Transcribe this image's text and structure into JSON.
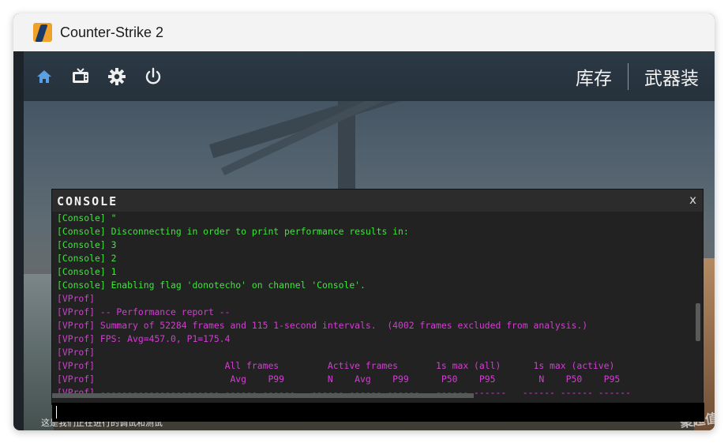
{
  "window": {
    "title": "Counter-Strike 2"
  },
  "nav": {
    "icons": [
      "home-icon",
      "tv-icon",
      "gear-icon",
      "power-icon"
    ],
    "items": [
      {
        "label": "库存"
      },
      {
        "label": "武器装"
      }
    ]
  },
  "console": {
    "title": "CONSOLE",
    "close_label": "x",
    "lines": [
      {
        "text": "[Console] \"",
        "color": "green"
      },
      {
        "text": "[Console] Disconnecting in order to print performance results in:",
        "color": "green"
      },
      {
        "text": "[Console] 3",
        "color": "green"
      },
      {
        "text": "[Console] 2",
        "color": "green"
      },
      {
        "text": "[Console] 1",
        "color": "green"
      },
      {
        "text": "[Console] Enabling flag 'donotecho' on channel 'Console'.",
        "color": "green"
      },
      {
        "text": "[VProf]",
        "color": "magenta"
      },
      {
        "text": "[VProf] -- Performance report --",
        "color": "magenta"
      },
      {
        "text": "[VProf] Summary of 52284 frames and 115 1-second intervals.  (4002 frames excluded from analysis.)",
        "color": "magenta"
      },
      {
        "text": "[VProf] FPS: Avg=457.0, P1=175.4",
        "color": "magenta"
      },
      {
        "text": "[VProf]",
        "color": "magenta"
      },
      {
        "text": "[VProf]                        All frames         Active frames       1s max (all)      1s max (active)",
        "color": "magenta"
      },
      {
        "text": "[VProf]                         Avg    P99        N    Avg    P99      P50    P95        N    P50    P95",
        "color": "magenta"
      },
      {
        "text": "[VProf] ---------------------- ------ ------   ------ ------ ------   ------ ------   ------ ------ ------",
        "color": "magenta"
      }
    ],
    "input_value": ""
  },
  "colors": {
    "green": "#3ee63c",
    "magenta": "#d23ed2",
    "console_bg": "#222222",
    "titlebar_bg": "#f3f3f3"
  },
  "footer": {
    "text": "这是我们正在进行的调试和测试",
    "watermark": "聚超值"
  }
}
